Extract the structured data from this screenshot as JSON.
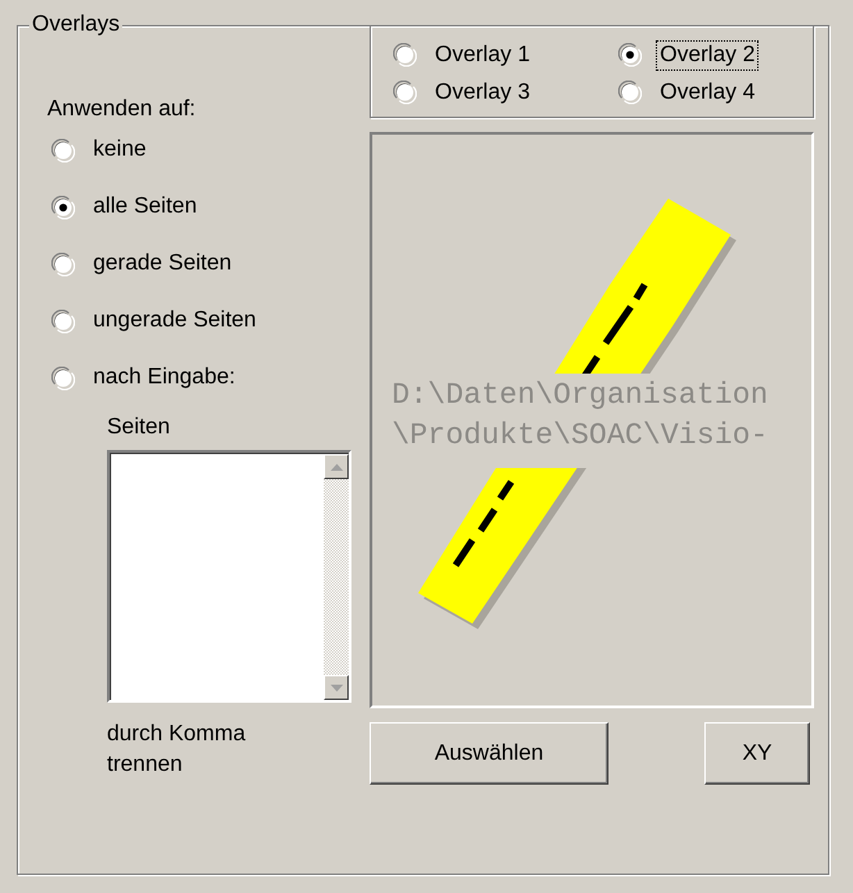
{
  "group": {
    "title": "Overlays"
  },
  "apply_to": {
    "label": "Anwenden auf:",
    "options": [
      {
        "label": "keine",
        "selected": false
      },
      {
        "label": "alle Seiten",
        "selected": true
      },
      {
        "label": "gerade Seiten",
        "selected": false
      },
      {
        "label": "ungerade Seiten",
        "selected": false
      },
      {
        "label": "nach Eingabe:",
        "selected": false
      }
    ]
  },
  "pages": {
    "label": "Seiten",
    "hint": "durch Komma trennen"
  },
  "overlays": [
    {
      "label": "Overlay 1",
      "selected": false,
      "focused": false
    },
    {
      "label": "Overlay 2",
      "selected": true,
      "focused": true
    },
    {
      "label": "Overlay 3",
      "selected": false,
      "focused": false
    },
    {
      "label": "Overlay 4",
      "selected": false,
      "focused": false
    }
  ],
  "preview": {
    "kind": "picture",
    "path_lines": [
      "D:\\Daten\\Organisation",
      "\\Produkte\\SOAC\\Visio-"
    ]
  },
  "buttons": [
    {
      "label": "Auswählen"
    },
    {
      "label": "XY"
    }
  ]
}
